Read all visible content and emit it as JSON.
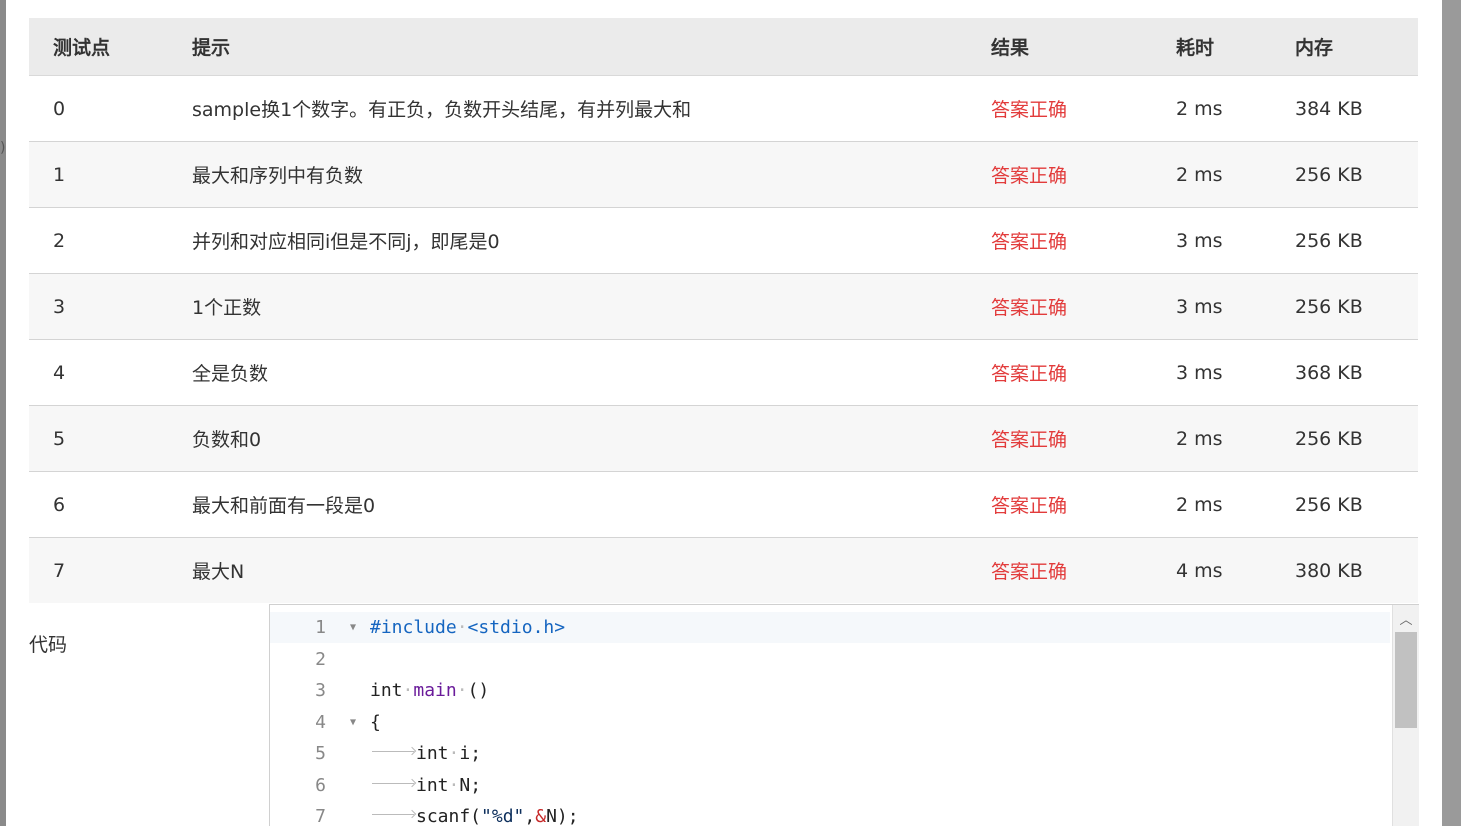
{
  "table": {
    "headers": {
      "case": "测试点",
      "hint": "提示",
      "result": "结果",
      "time": "耗时",
      "memory": "内存"
    },
    "rows": [
      {
        "case": "0",
        "hint": "sample换1个数字。有正负，负数开头结尾，有并列最大和",
        "result": "答案正确",
        "time": "2 ms",
        "memory": "384 KB"
      },
      {
        "case": "1",
        "hint": "最大和序列中有负数",
        "result": "答案正确",
        "time": "2 ms",
        "memory": "256 KB"
      },
      {
        "case": "2",
        "hint": "并列和对应相同i但是不同j，即尾是0",
        "result": "答案正确",
        "time": "3 ms",
        "memory": "256 KB"
      },
      {
        "case": "3",
        "hint": "1个正数",
        "result": "答案正确",
        "time": "3 ms",
        "memory": "256 KB"
      },
      {
        "case": "4",
        "hint": "全是负数",
        "result": "答案正确",
        "time": "3 ms",
        "memory": "368 KB"
      },
      {
        "case": "5",
        "hint": "负数和0",
        "result": "答案正确",
        "time": "2 ms",
        "memory": "256 KB"
      },
      {
        "case": "6",
        "hint": "最大和前面有一段是0",
        "result": "答案正确",
        "time": "2 ms",
        "memory": "256 KB"
      },
      {
        "case": "7",
        "hint": "最大N",
        "result": "答案正确",
        "time": "4 ms",
        "memory": "380 KB"
      }
    ]
  },
  "code_section": {
    "label": "代码",
    "lines": [
      {
        "no": "1",
        "text": "#include <stdio.h>"
      },
      {
        "no": "2",
        "text": ""
      },
      {
        "no": "3",
        "text": "int main ()"
      },
      {
        "no": "4",
        "text": "{"
      },
      {
        "no": "5",
        "text": "int i;"
      },
      {
        "no": "6",
        "text": "int N;"
      },
      {
        "no": "7",
        "text": "scanf(\"%d\",&N);"
      }
    ]
  },
  "colors": {
    "result_ok": "#e23b3b",
    "header_bg": "#ebebeb",
    "stripe_bg": "#f7f7f7"
  },
  "icons": {
    "fold_marker": "fold-triangle-icon",
    "scroll_up": "chevron-up-icon"
  }
}
